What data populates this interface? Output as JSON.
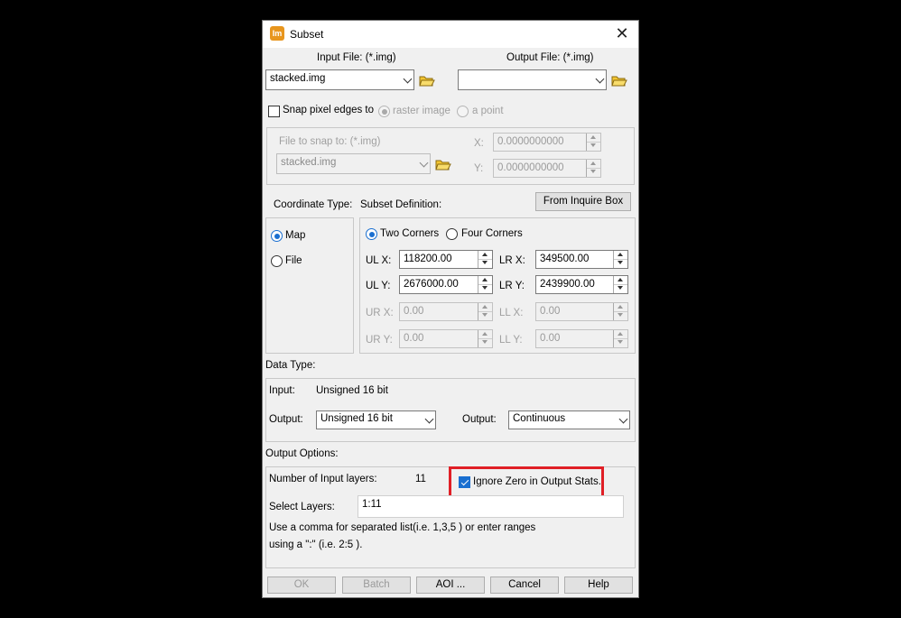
{
  "window": {
    "title": "Subset",
    "app_icon": "Im",
    "close": "✕"
  },
  "files": {
    "input_label": "Input File: (*.img)",
    "input_value": "stacked.img",
    "output_label": "Output File: (*.img)",
    "output_value": ""
  },
  "snap": {
    "checkbox_label": "Snap pixel edges to",
    "checked": false,
    "option_raster": "raster image",
    "option_point": "a point",
    "file_label": "File to snap to: (*.img)",
    "file_value": "stacked.img",
    "x_label": "X:",
    "x_value": "0.0000000000",
    "y_label": "Y:",
    "y_value": "0.0000000000"
  },
  "coordinate": {
    "label": "Coordinate Type:",
    "options": [
      "Map",
      "File"
    ],
    "selected": "Map"
  },
  "subset": {
    "label": "Subset Definition:",
    "inquire_button": "From Inquire Box",
    "corner_options": [
      "Two Corners",
      "Four Corners"
    ],
    "corner_selected": "Two Corners",
    "ulx_label": "UL X:",
    "ulx_value": "118200.00",
    "uly_label": "UL Y:",
    "uly_value": "2676000.00",
    "lrx_label": "LR X:",
    "lrx_value": "349500.00",
    "lry_label": "LR Y:",
    "lry_value": "2439900.00",
    "urx_label": "UR X:",
    "urx_value": "0.00",
    "ury_label": "UR Y:",
    "ury_value": "0.00",
    "llx_label": "LL X:",
    "llx_value": "0.00",
    "lly_label": "LL Y:",
    "lly_value": "0.00"
  },
  "datatype": {
    "label": "Data Type:",
    "input_label": "Input:",
    "input_value": "Unsigned 16 bit",
    "output_label": "Output:",
    "output_value": "Unsigned 16 bit",
    "output2_label": "Output:",
    "output2_value": "Continuous"
  },
  "options": {
    "label": "Output Options:",
    "num_layers_label": "Number of Input layers:",
    "num_layers_value": "11",
    "ignore_zero_label": "Ignore Zero in Output Stats.",
    "ignore_zero_checked": true,
    "select_layers_label": "Select Layers:",
    "select_layers_value": "1:11",
    "help_line1": "Use a comma for separated list(i.e. 1,3,5 ) or enter ranges",
    "help_line2": "using a \":\" (i.e. 2:5 )."
  },
  "buttons": {
    "ok": "OK",
    "batch": "Batch",
    "aoi": "AOI ...",
    "cancel": "Cancel",
    "help": "Help"
  },
  "colors": {
    "accent": "#1a6fd0",
    "highlight": "#e01f26",
    "app_icon": "#e8961e"
  }
}
